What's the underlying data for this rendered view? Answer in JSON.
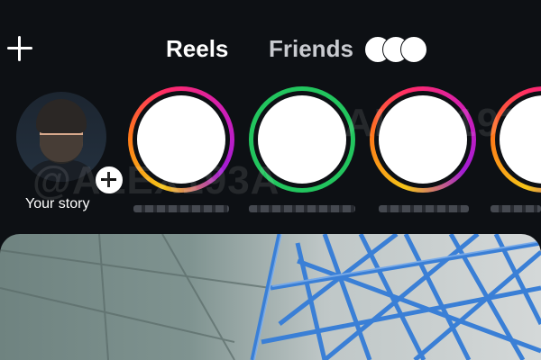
{
  "header": {
    "tabs": [
      {
        "label": "Reels"
      },
      {
        "label": "Friends"
      }
    ]
  },
  "stories": {
    "own": {
      "label": "Your story"
    }
  },
  "watermarks": [
    "@ALEX193A",
    "@ALEX193A"
  ],
  "colors": {
    "background": "#0d1014",
    "close_friends_ring": "#22c55e"
  },
  "icons": {
    "create": "plus-icon",
    "friends": "friends-avatars-icon",
    "add_story": "plus-circle-icon"
  }
}
